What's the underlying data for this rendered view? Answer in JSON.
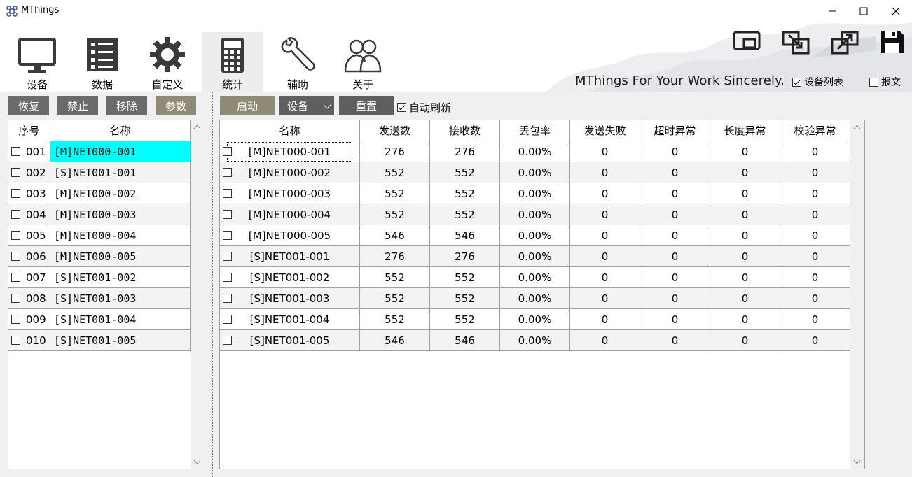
{
  "window": {
    "title": "MThings",
    "icon": "app-logo-icon"
  },
  "nav": [
    {
      "label": "设备",
      "icon": "monitor-icon"
    },
    {
      "label": "数据",
      "icon": "checklist-icon"
    },
    {
      "label": "自定义",
      "icon": "gear-icon"
    },
    {
      "label": "统计",
      "icon": "calculator-icon"
    },
    {
      "label": "辅助",
      "icon": "wrench-icon"
    },
    {
      "label": "关于",
      "icon": "users-icon"
    }
  ],
  "header": {
    "tagline": "MThings For Your Work Sincerely.",
    "device_list_label": "设备列表",
    "device_list_checked": true,
    "message_label": "报文",
    "message_checked": false
  },
  "left_toolbar": {
    "restore": "恢复",
    "disable": "禁止",
    "remove": "移除",
    "params": "参数"
  },
  "right_toolbar": {
    "start": "启动",
    "device": "设备",
    "reset": "重置",
    "auto_refresh": "自动刷新",
    "auto_refresh_checked": true
  },
  "left_table": {
    "headers": [
      "序号",
      "名称"
    ],
    "rows": [
      {
        "no": "001",
        "name": "[M]NET000-001"
      },
      {
        "no": "002",
        "name": "[S]NET001-001"
      },
      {
        "no": "003",
        "name": "[M]NET000-002"
      },
      {
        "no": "004",
        "name": "[M]NET000-003"
      },
      {
        "no": "005",
        "name": "[M]NET000-004"
      },
      {
        "no": "006",
        "name": "[M]NET000-005"
      },
      {
        "no": "007",
        "name": "[S]NET001-002"
      },
      {
        "no": "008",
        "name": "[S]NET001-003"
      },
      {
        "no": "009",
        "name": "[S]NET001-004"
      },
      {
        "no": "010",
        "name": "[S]NET001-005"
      }
    ]
  },
  "right_table": {
    "headers": [
      "名称",
      "发送数",
      "接收数",
      "丢包率",
      "发送失败",
      "超时异常",
      "长度异常",
      "校验异常"
    ],
    "rows": [
      [
        "[M]NET000-001",
        "276",
        "276",
        "0.00%",
        "0",
        "0",
        "0",
        "0"
      ],
      [
        "[M]NET000-002",
        "552",
        "552",
        "0.00%",
        "0",
        "0",
        "0",
        "0"
      ],
      [
        "[M]NET000-003",
        "552",
        "552",
        "0.00%",
        "0",
        "0",
        "0",
        "0"
      ],
      [
        "[M]NET000-004",
        "552",
        "552",
        "0.00%",
        "0",
        "0",
        "0",
        "0"
      ],
      [
        "[M]NET000-005",
        "546",
        "546",
        "0.00%",
        "0",
        "0",
        "0",
        "0"
      ],
      [
        "[S]NET001-001",
        "276",
        "276",
        "0.00%",
        "0",
        "0",
        "0",
        "0"
      ],
      [
        "[S]NET001-002",
        "552",
        "552",
        "0.00%",
        "0",
        "0",
        "0",
        "0"
      ],
      [
        "[S]NET001-003",
        "552",
        "552",
        "0.00%",
        "0",
        "0",
        "0",
        "0"
      ],
      [
        "[S]NET001-004",
        "552",
        "552",
        "0.00%",
        "0",
        "0",
        "0",
        "0"
      ],
      [
        "[S]NET001-005",
        "546",
        "546",
        "0.00%",
        "0",
        "0",
        "0",
        "0"
      ]
    ]
  },
  "colors": {
    "selected_row": "#00ffff",
    "button_gray": "#6b6b6b",
    "button_olive": "#8e8a76"
  }
}
